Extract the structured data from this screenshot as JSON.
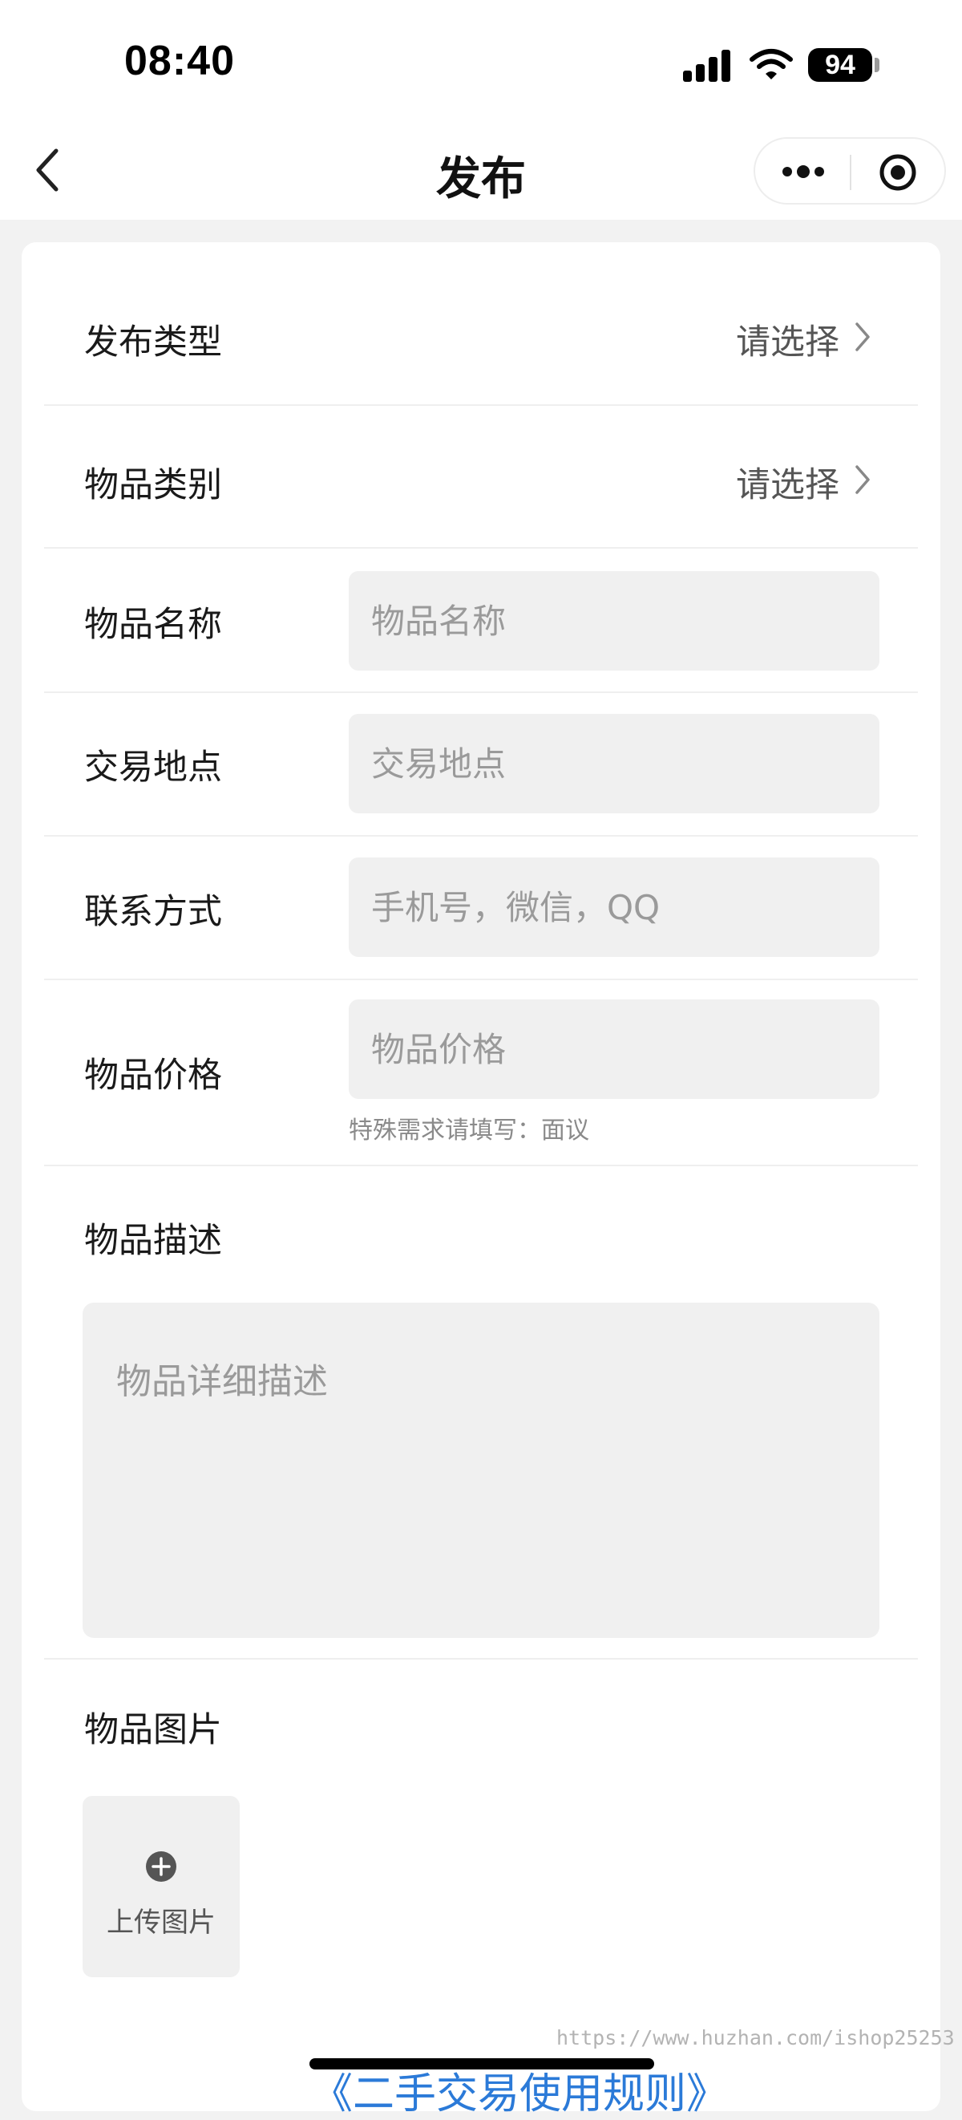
{
  "status_bar": {
    "time": "08:40",
    "battery": "94",
    "icons": [
      "signal-icon",
      "wifi-icon",
      "battery-icon"
    ]
  },
  "nav": {
    "title": "发布",
    "icons": [
      "back-icon",
      "more-icon",
      "target-icon"
    ]
  },
  "form": {
    "publish_type": {
      "label": "发布类型",
      "value": "请选择"
    },
    "category": {
      "label": "物品类别",
      "value": "请选择"
    },
    "item_name": {
      "label": "物品名称",
      "placeholder": "物品名称"
    },
    "location": {
      "label": "交易地点",
      "placeholder": "交易地点"
    },
    "contact": {
      "label": "联系方式",
      "placeholder": "手机号，微信，QQ"
    },
    "price": {
      "label": "物品价格",
      "placeholder": "物品价格",
      "hint": "特殊需求请填写：面议"
    },
    "description": {
      "label": "物品描述",
      "placeholder": "物品详细描述"
    },
    "images": {
      "label": "物品图片",
      "upload_label": "上传图片"
    }
  },
  "footer": {
    "rules_link": "《二手交易使用规则》",
    "watermark": "https://www.huzhan.com/ishop25253"
  },
  "colors": {
    "background": "#f2f2f2",
    "input_bg": "#f0f0f0",
    "link": "#2b7ad8"
  }
}
